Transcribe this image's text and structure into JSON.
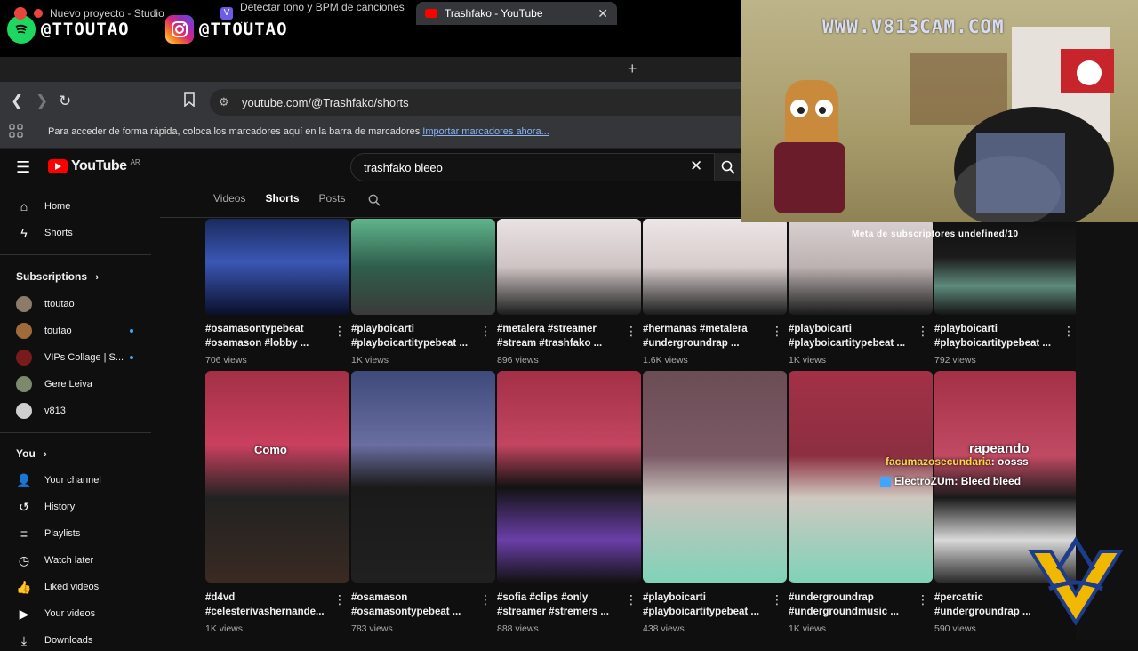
{
  "overlay": {
    "spotify_handle": "@TTOUTAO",
    "instagram_handle": "@TTOUTAO",
    "cam_watermark": "WWW.V813CAM.COM",
    "goal_text": "Meta de subscriptores undefined/10",
    "chat": [
      {
        "user": "facumazosecundaria",
        "text": ": oosss"
      },
      {
        "user": "ElectroZUm",
        "text": ": Bleed bleed"
      }
    ],
    "caption_rapeando": "rapeando",
    "caption_como": "Como"
  },
  "browser": {
    "tabs": [
      {
        "label": "Nuevo proyecto - Studio",
        "color": "#e8453c"
      },
      {
        "label": "Detectar tono y BPM de canciones ...",
        "color": "#6c5ce7"
      },
      {
        "label": "Trashfako - YouTube",
        "color": "#ff0000"
      }
    ],
    "url": "youtube.com/@Trashfako/shorts",
    "bookmark_message": "Para acceder de forma rápida, coloca los marcadores aquí en la barra de marcadores",
    "bookmark_link": "Importar marcadores ahora..."
  },
  "youtube": {
    "logo_text": "YouTube",
    "logo_cc": "AR",
    "search_value": "trashfako bleeo",
    "sidebar": {
      "home": "Home",
      "shorts": "Shorts",
      "subscriptions_header": "Subscriptions",
      "subscriptions": [
        {
          "name": "ttoutao",
          "color": "#8d7b6a",
          "live": false
        },
        {
          "name": "toutao",
          "color": "#a06b3a",
          "live": true
        },
        {
          "name": "VIPs Collage | S...",
          "color": "#7a1b1b",
          "live": true
        },
        {
          "name": "Gere Leiva",
          "color": "#7d8a6a",
          "live": false
        },
        {
          "name": "v813",
          "color": "#cfcfcf",
          "live": false
        }
      ],
      "you_header": "You",
      "you_items": [
        {
          "label": "Your channel",
          "icon": "person-icon",
          "glyph": "👤"
        },
        {
          "label": "History",
          "icon": "history-icon",
          "glyph": "↺"
        },
        {
          "label": "Playlists",
          "icon": "playlist-icon",
          "glyph": "≡"
        },
        {
          "label": "Watch later",
          "icon": "clock-icon",
          "glyph": "◷"
        },
        {
          "label": "Liked videos",
          "icon": "thumb-up-icon",
          "glyph": "👍"
        },
        {
          "label": "Your videos",
          "icon": "video-icon",
          "glyph": "▶"
        },
        {
          "label": "Downloads",
          "icon": "download-icon",
          "glyph": "⤓"
        }
      ]
    },
    "channel_tabs": [
      "Videos",
      "Shorts",
      "Posts"
    ],
    "shorts_row1": [
      {
        "title": "#osamasontypebeat\n#osamason #lobby ...",
        "views": "706 views",
        "bg": "linear-gradient(180deg,#1b2a5e 0%,#3b57b5 45%,#0a0f2a 100%)"
      },
      {
        "title": "#playboicarti\n#playboicartitypebeat ...",
        "views": "1K views",
        "bg": "linear-gradient(180deg,#5fb58c 0%,#2f5e4b 50%,#3a3a3a 100%)"
      },
      {
        "title": "#metalera #streamer\n#stream #trashfako ...",
        "views": "896 views",
        "bg": "linear-gradient(180deg,#e9e2e3 0%,#cfc4c4 50%,#1c1c1c 100%)"
      },
      {
        "title": "#hermanas #metalera\n#undergroundrap ...",
        "views": "1.6K views",
        "bg": "linear-gradient(180deg,#ece6e6 0%,#d7cccc 50%,#1c1c1c 100%)"
      },
      {
        "title": "#playboicarti\n#playboicartitypebeat ...",
        "views": "1K views",
        "bg": "linear-gradient(180deg,#d9d1d1 0%,#bdb2b2 50%,#1a1a1a 100%)"
      },
      {
        "title": "#playboicarti\n#playboicartitypebeat ...",
        "views": "792 views",
        "bg": "linear-gradient(180deg,#101010 0%,#1b1b1b 40%,#5e8a7c 70%,#151515 100%)"
      }
    ],
    "shorts_row2": [
      {
        "title": "#d4vd\n#celesterivashernande...",
        "views": "1K views",
        "bg": "linear-gradient(180deg,#a33047 0%,#c9405e 35%,#222 60%,#3a2a22 100%)"
      },
      {
        "title": "#osamason\n#osamasontypebeat ...",
        "views": "783 views",
        "bg": "linear-gradient(180deg,#3d4a7a 0%,#6a6ea0 35%,#1a1a1a 55%,#202020 100%)"
      },
      {
        "title": "#sofia #clips #only\n#streamer #stremers ...",
        "views": "888 views",
        "bg": "linear-gradient(180deg,#a33047 0%,#c34560 35%,#121212 55%,#6a3fa8 80%,#121212 100%)"
      },
      {
        "title": "#playboicarti\n#playboicartitypebeat ...",
        "views": "438 views",
        "bg": "linear-gradient(180deg,#6b4d55 0%,#7b5a66 40%,#c9c4bd 60%,#7fd3b8 100%)"
      },
      {
        "title": "#undergroundrap\n#undergroundmusic ...",
        "views": "1K views",
        "bg": "linear-gradient(180deg,#a33047 0%,#8c2f40 40%,#cfc8c0 60%,#7fd3b8 100%)"
      },
      {
        "title": "#percatric\n#undergroundrap ...",
        "views": "590 views",
        "bg": "linear-gradient(180deg,#a33047 0%,#c14a63 40%,#1a1a1a 60%,#d9d9d9 80%,#2a2a2a 100%)"
      }
    ]
  }
}
